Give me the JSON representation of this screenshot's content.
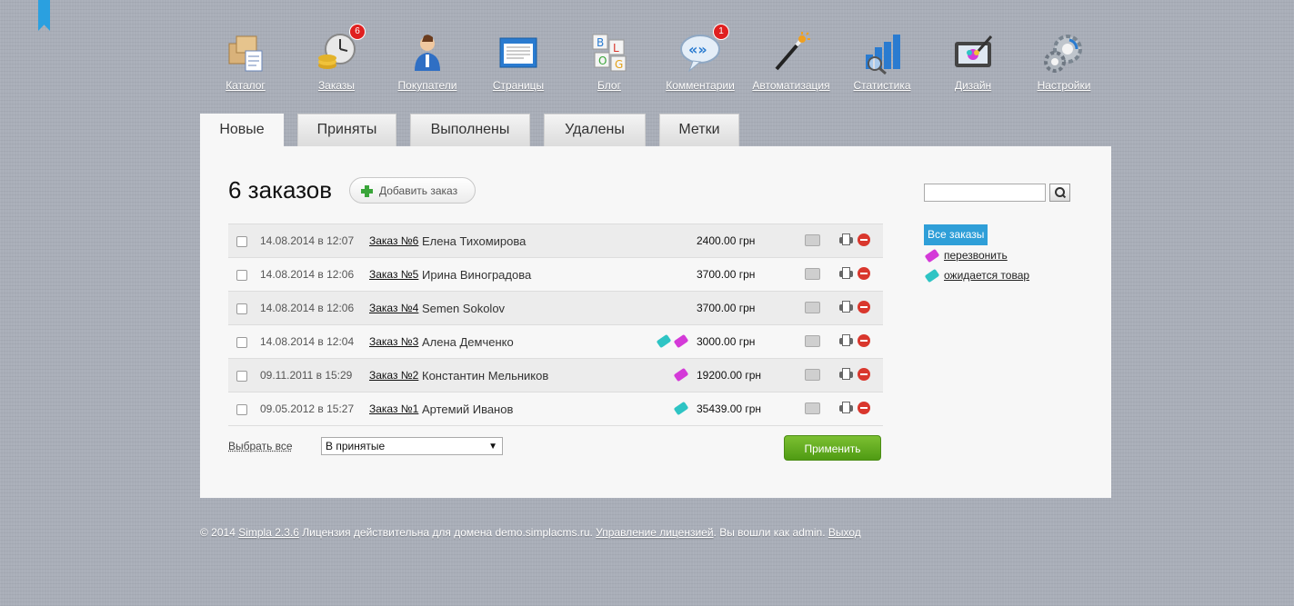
{
  "nav": {
    "items": [
      {
        "label": "Каталог",
        "icon": "catalog-icon"
      },
      {
        "label": "Заказы",
        "icon": "orders-icon",
        "badge": "6"
      },
      {
        "label": "Покупатели",
        "icon": "customers-icon"
      },
      {
        "label": "Страницы",
        "icon": "pages-icon"
      },
      {
        "label": "Блог",
        "icon": "blog-icon"
      },
      {
        "label": "Комментарии",
        "icon": "comments-icon",
        "badge": "1"
      },
      {
        "label": "Автоматизация",
        "icon": "automation-icon"
      },
      {
        "label": "Статистика",
        "icon": "statistics-icon"
      },
      {
        "label": "Дизайн",
        "icon": "design-icon"
      },
      {
        "label": "Настройки",
        "icon": "settings-icon"
      }
    ]
  },
  "tabs": [
    {
      "label": "Новые",
      "active": true
    },
    {
      "label": "Приняты"
    },
    {
      "label": "Выполнены"
    },
    {
      "label": "Удалены"
    },
    {
      "label": "Метки"
    }
  ],
  "main": {
    "heading": "6 заказов",
    "add_order_label": "Добавить заказ"
  },
  "orders": [
    {
      "date": "14.08.2014 в 12:07",
      "order": "Заказ №6",
      "customer": "Елена Тихомирова",
      "price": "2400.00 грн",
      "tags": []
    },
    {
      "date": "14.08.2014 в 12:06",
      "order": "Заказ №5",
      "customer": "Ирина Виноградова",
      "price": "3700.00 грн",
      "tags": []
    },
    {
      "date": "14.08.2014 в 12:06",
      "order": "Заказ №4",
      "customer": "Semen Sokolov",
      "price": "3700.00 грн",
      "tags": []
    },
    {
      "date": "14.08.2014 в 12:04",
      "order": "Заказ №3",
      "customer": "Алена Демченко",
      "price": "3000.00 грн",
      "tags": [
        "teal",
        "pink"
      ]
    },
    {
      "date": "09.11.2011 в 15:29",
      "order": "Заказ №2",
      "customer": "Константин Мельников",
      "price": "19200.00 грн",
      "tags": [
        "pink"
      ]
    },
    {
      "date": "09.05.2012 в 15:27",
      "order": "Заказ №1",
      "customer": "Артемий Иванов",
      "price": "35439.00 грн",
      "tags": [
        "teal"
      ]
    }
  ],
  "bulk": {
    "select_all": "Выбрать все",
    "action_value": "В принятые",
    "apply_label": "Применить"
  },
  "sidebar": {
    "all_orders": "Все заказы",
    "labels": [
      {
        "name": "перезвонить",
        "color": "pink"
      },
      {
        "name": "ожидается товар",
        "color": "teal"
      }
    ]
  },
  "footer": {
    "prefix": "© 2014 ",
    "version": "Simpla 2.3.6",
    "license_text": " Лицензия действительна для домена demo.simplacms.ru. ",
    "manage_license": "Управление лицензией",
    "logged_in": ". Вы вошли как admin. ",
    "logout": "Выход"
  },
  "colors": {
    "accent": "#2f9fd8",
    "apply": "#5aa81c",
    "badge": "#e02020",
    "tag_teal": "#2ec4c4",
    "tag_pink": "#d43ad8"
  }
}
